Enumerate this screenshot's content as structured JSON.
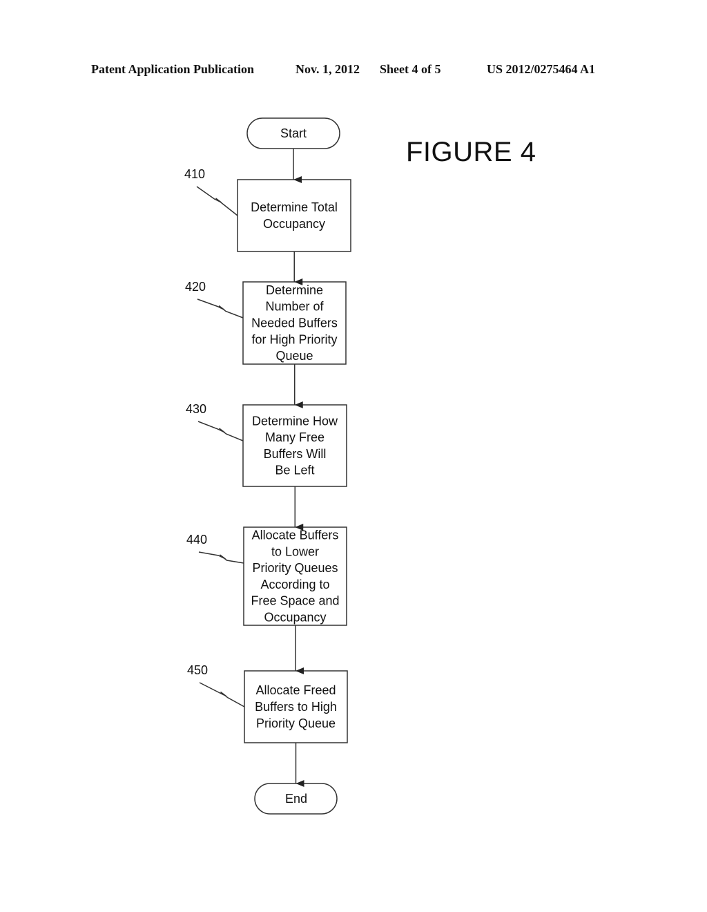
{
  "header": {
    "publication_type": "Patent Application Publication",
    "date": "Nov. 1, 2012",
    "sheet": "Sheet 4 of 5",
    "patent_number": "US 2012/0275464 A1"
  },
  "figure": {
    "title": "FIGURE 4"
  },
  "flowchart": {
    "start_label": "Start",
    "end_label": "End",
    "steps": [
      {
        "ref": "410",
        "lines": [
          "Determine Total",
          "Occupancy"
        ]
      },
      {
        "ref": "420",
        "lines": [
          "Determine",
          "Number of",
          "Needed Buffers",
          "for High Priority",
          "Queue"
        ]
      },
      {
        "ref": "430",
        "lines": [
          "Determine How",
          "Many Free",
          "Buffers Will",
          "Be Left"
        ]
      },
      {
        "ref": "440",
        "lines": [
          "Allocate Buffers",
          "to Lower",
          "Priority Queues",
          "According to",
          "Free Space and",
          "Occupancy"
        ]
      },
      {
        "ref": "450",
        "lines": [
          "Allocate Freed",
          "Buffers to High",
          "Priority Queue"
        ]
      }
    ]
  }
}
